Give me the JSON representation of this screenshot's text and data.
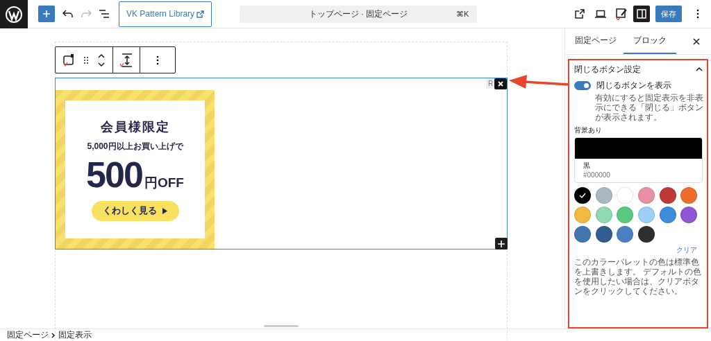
{
  "top_bar": {
    "pattern_library_button": "VK Pattern Library",
    "document_title": "トップページ · 固定ページ",
    "shortcut": "⌘K",
    "save_button": "保存"
  },
  "canvas": {
    "close_label": "R",
    "banner": {
      "title": "会員様限定",
      "condition": "5,000円以上お買い上げで",
      "amount": "500",
      "unit": "円OFF",
      "cta": "くわしく見る"
    }
  },
  "sidebar": {
    "tabs": [
      {
        "label": "固定ページ",
        "selected": false
      },
      {
        "label": "ブロック",
        "selected": true
      }
    ],
    "panel": {
      "title": "閉じるボタン設定",
      "expanded": true,
      "toggle": {
        "label": "閉じるボタンを表示",
        "on": true,
        "help": "有効にすると固定表示を非表示にできる「閉じる」ボタンが表示されます。"
      },
      "color_label": "背景あり",
      "selected_color": {
        "name": "黒",
        "hex": "#000000"
      },
      "swatches": [
        {
          "color": "#000000",
          "selected": true
        },
        {
          "color": "#abb8c3",
          "selected": false
        },
        {
          "color": "#ffffff",
          "selected": false
        },
        {
          "color": "#e88ea5",
          "selected": false
        },
        {
          "color": "#c0383a",
          "selected": false
        },
        {
          "color": "#ec6e2c",
          "selected": false
        },
        {
          "color": "#f0ba40",
          "selected": false
        },
        {
          "color": "#8fdab5",
          "selected": false
        },
        {
          "color": "#5ac87f",
          "selected": false
        },
        {
          "color": "#9ccff7",
          "selected": false
        },
        {
          "color": "#3c8dd9",
          "selected": false
        },
        {
          "color": "#8e55d5",
          "selected": false
        },
        {
          "color": "#4275ae",
          "selected": false
        },
        {
          "color": "#335c8e",
          "selected": false
        },
        {
          "color": "#4a80c2",
          "selected": false
        },
        {
          "color": "#2f2f2f",
          "selected": false
        }
      ],
      "clear_button": "クリア",
      "note": "このカラーパレットの色は標準色を上書きします。 デフォルトの色を使用したい場合は、クリアボタンをクリックしてください。"
    }
  },
  "breadcrumb": [
    "固定ページ",
    "固定表示"
  ]
}
